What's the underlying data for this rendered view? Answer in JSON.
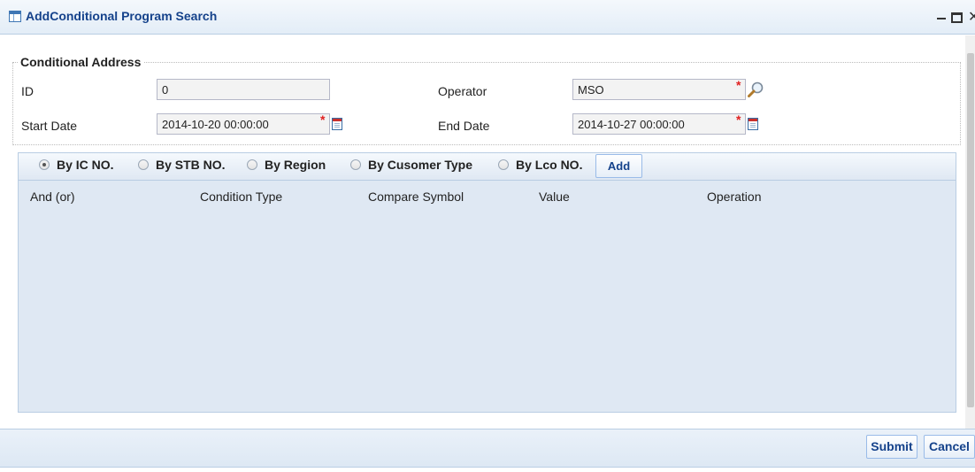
{
  "window": {
    "title": "AddConditional Program Search",
    "icon": "grid-window-icon"
  },
  "fieldset": {
    "legend": "Conditional Address",
    "id_label": "ID",
    "id_value": "0",
    "operator_label": "Operator",
    "operator_value": "MSO",
    "start_date_label": "Start Date",
    "start_date_value": "2014-10-20 00:00:00",
    "end_date_label": "End Date",
    "end_date_value": "2014-10-27 00:00:00",
    "required_mark": "*"
  },
  "filter": {
    "options": [
      "By IC NO.",
      "By STB NO.",
      "By Region",
      "By Cusomer Type",
      "By Lco NO."
    ],
    "selected": "By IC NO.",
    "add_label": "Add"
  },
  "grid": {
    "columns": [
      "And (or)",
      "Condition Type",
      "Compare Symbol",
      "Value",
      "Operation"
    ]
  },
  "footer": {
    "submit_label": "Submit",
    "cancel_label": "Cancel"
  },
  "colors": {
    "title_text": "#15428b",
    "panel_bg": "#dfe8f3",
    "required": "#e02020"
  }
}
